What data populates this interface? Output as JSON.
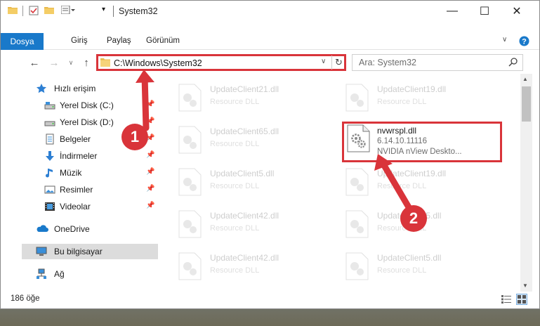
{
  "window": {
    "title": "System32"
  },
  "ribbon": {
    "tabs": [
      "Dosya",
      "Giriş",
      "Paylaş",
      "Görünüm"
    ]
  },
  "address": {
    "path": "C:\\Windows\\System32"
  },
  "search": {
    "placeholder": "Ara: System32"
  },
  "navpane": {
    "quick_access": "Hızlı erişim",
    "items": [
      {
        "label": "Yerel Disk (C:)",
        "icon": "drive-icon"
      },
      {
        "label": "Yerel Disk (D:)",
        "icon": "drive-icon"
      },
      {
        "label": "Belgeler",
        "icon": "documents-icon"
      },
      {
        "label": "İndirmeler",
        "icon": "download-icon"
      },
      {
        "label": "Müzik",
        "icon": "music-icon"
      },
      {
        "label": "Resimler",
        "icon": "pictures-icon"
      },
      {
        "label": "Videolar",
        "icon": "videos-icon"
      }
    ],
    "onedrive": "OneDrive",
    "this_pc": "Bu bilgisayar",
    "network": "Ağ"
  },
  "files": {
    "left_column": [
      {
        "name": "UpdateClient21.dll",
        "type": "Resource DLL"
      },
      {
        "name": "UpdateClient65.dll",
        "type": "Resource DLL"
      },
      {
        "name": "UpdateClient5.dll",
        "type": "Resource DLL"
      },
      {
        "name": "UpdateClient42.dll",
        "type": "Resource DLL"
      },
      {
        "name": "UpdateClient42.dll",
        "type": "Resource DLL"
      }
    ],
    "right_column": [
      {
        "name": "UpdateClient19.dll",
        "type": "Resource DLL"
      },
      {
        "name": "UpdateClient19.dll",
        "type": "Resource DLL"
      },
      {
        "name": "UpdateClient5.dll",
        "type": "Resource DLL"
      },
      {
        "name": "UpdateClient5.dll",
        "type": "Resource DLL"
      }
    ],
    "highlighted": {
      "name": "nvwrspl.dll",
      "version": "6.14.10.11116",
      "description": "NVIDIA nView Deskto..."
    }
  },
  "status": {
    "item_count": "186 öğe"
  },
  "annotations": {
    "step1": "1",
    "step2": "2",
    "color": "#d9343a"
  },
  "colors": {
    "accent": "#1979ca",
    "highlight": "#d9343a"
  }
}
